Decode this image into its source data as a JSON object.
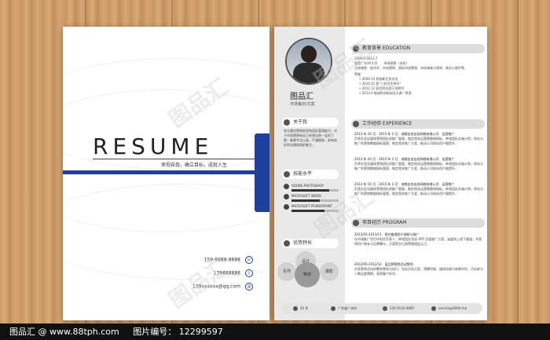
{
  "cover": {
    "title": "RESUME",
    "tagline": "审视自我，确立目标，成就人生",
    "phone1": "159-8888-8888",
    "phone2": "139888888",
    "email": "139xxxxxx@qq.com"
  },
  "profile": {
    "name": "图品汇",
    "subtitle": "市场策划/文案",
    "about_heading": "关于我",
    "about_text": "有丰富的营销经验和团队管理能力，对于市场营销有自己的想法和一定的了解，做事专注认真，严谨细致，具有良好的沟通和组织能力。",
    "skills_heading": "技能水平",
    "skills": [
      {
        "label": "ADOBE PHOTOSHOP",
        "level": 0.8
      },
      {
        "label": "MICROSOFT WORD",
        "level": 0.6
      },
      {
        "label": "MICROSOFT POWERPOINT",
        "level": 0.7
      }
    ],
    "strengths_heading": "优势特长",
    "strengths": [
      "写作",
      "策划",
      "摄影",
      "设计"
    ]
  },
  "education": {
    "heading": "教育背景 EDUCATION",
    "period": "2009.9-2013.7",
    "school": "我是广东XX大学",
    "major": "市场营销（本科）",
    "courses": "主修课程：经济学、市场营销、国际市场营销、市场调查与预测、商业心理学等。",
    "awards_label": "荣誉",
    "awards": [
      "2009.10 获校新生奖学金",
      "2010.11 获“三好学生称号”",
      "2012.12 获优秀社团干部称号",
      "2013.4 挑战杯创新创业大赛一等奖"
    ]
  },
  "experience": {
    "heading": "工作经验 EXPERIENCE",
    "items": [
      {
        "date": "2013 年 10 月 - 2015 年 2 月",
        "company": "成都自由自由网络有限公司",
        "role": "运营推广",
        "desc": "负责社会化媒体营销团队的推广管理，制定相关运营策略和指标，带领团队实施计划；网站与推广的营销数据指标管理，制定相关推广方案，推动公司网站用户量提升。"
      },
      {
        "date": "2013 年 10 月 - 2015 年 2 月",
        "company": "成都自由自由网络有限公司",
        "role": "运营推广",
        "desc": "负责社会化媒体营销团队的推广管理，制定相关运营策略和指标，带领团队实施计划；网站与推广的营销数据指标管理，制定相关推广方案，推动公司网站用户量提升。"
      },
      {
        "date": "2013 年 10 月 - 2015 年 2 月",
        "company": "成都自由自由网络有限公司",
        "role": "运营推广",
        "desc": "负责社会化媒体营销团队的推广管理，制定相关运营策略和指标，带领团队实施计划；网站与推广的营销数据指标管理，制定相关推广方案，推动公司网站用户量提升。"
      }
    ]
  },
  "projects": {
    "heading": "项目经历 PROGRAM",
    "items": [
      {
        "date": "2013/05-2013/11",
        "title": "职内推通用户调研与推广",
        "desc": "在市场推广项目中担任负责人，带领团队完成 APP 全面推广方案，涵盖线上线下渠道，共获得用户增长与品牌曝光，方案提交后获得管理层认可。"
      },
      {
        "date": "2012/06-2012/12",
        "title": "某品牌营销活动策划",
        "desc": "负责营销活动的整体策划与执行，包括活动方案、预算控制、媒体投放与效果评估，活动参与人数远超预期，获得客户好评。"
      }
    ]
  },
  "footer": {
    "age": "24 岁",
    "location": "广东省广州市",
    "phone": "135-0135-0000",
    "email": "service@500d.me"
  },
  "watermark": "图品汇",
  "bottom_bar": {
    "site": "图品汇 @ www.88tph.com",
    "id_text": "图片编号： 12299597"
  }
}
